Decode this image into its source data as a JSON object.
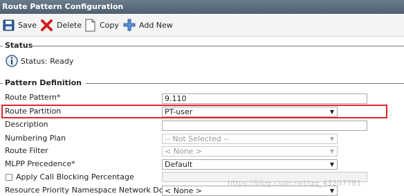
{
  "window": {
    "title": "Route Pattern Configuration"
  },
  "toolbar": {
    "save_label": "Save",
    "delete_label": "Delete",
    "copy_label": "Copy",
    "add_new_label": "Add New"
  },
  "status_section": {
    "title": "Status",
    "message": "Status: Ready"
  },
  "pattern_section": {
    "title": "Pattern Definition",
    "fields": [
      {
        "label": "Route Pattern",
        "required": "*",
        "value": "9.110",
        "type": "text"
      },
      {
        "label": "Route Partition",
        "value": "PT-user",
        "type": "select"
      },
      {
        "label": "Description",
        "value": "",
        "type": "text"
      },
      {
        "label": "Numbering Plan",
        "value": "-- Not Selected --",
        "type": "select",
        "disabled": true
      },
      {
        "label": "Route Filter",
        "value": "< None >",
        "type": "select",
        "disabled": true
      },
      {
        "label": "MLPP Precedence",
        "required": "*",
        "value": "Default",
        "type": "select"
      },
      {
        "label": "Apply Call Blocking Percentage",
        "value": "",
        "type": "checkbox-text",
        "disabled": true
      },
      {
        "label": "Resource Priority Namespace Network Domain",
        "value": "< None >",
        "type": "select"
      }
    ]
  },
  "watermark": "https://blog.csdn.net/qq_43207781",
  "colors": {
    "highlight": "#e0252a",
    "titlebar": "#5a6b7c"
  }
}
